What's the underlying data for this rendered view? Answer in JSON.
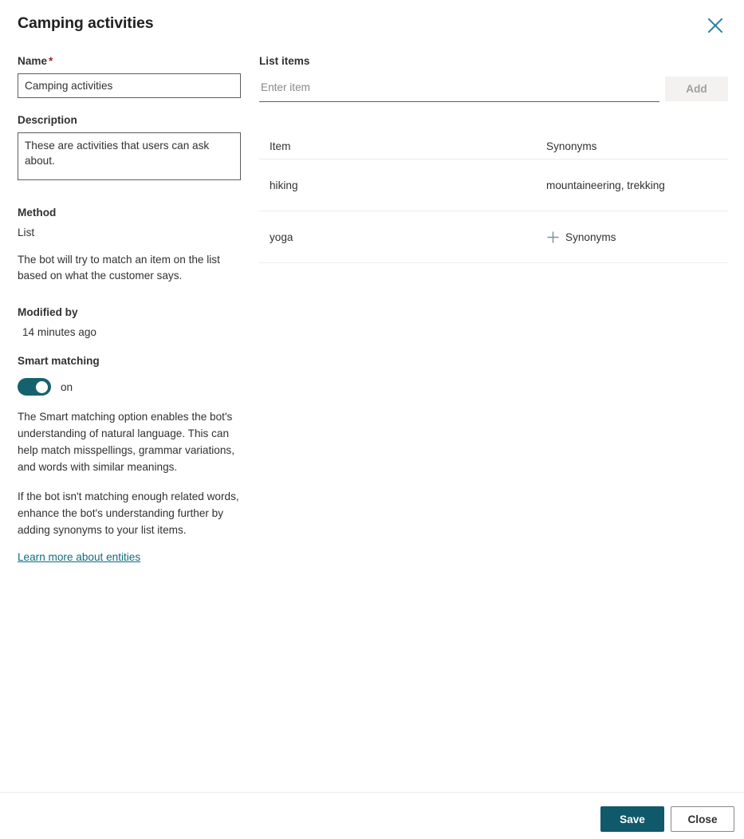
{
  "header": {
    "title": "Camping activities",
    "close_icon": "close-icon"
  },
  "form": {
    "name": {
      "label": "Name",
      "required_marker": "*",
      "value": "Camping activities",
      "placeholder": ""
    },
    "description": {
      "label": "Description",
      "value": "These are activities that users can ask about.",
      "placeholder": ""
    },
    "method": {
      "label": "Method",
      "value": "List",
      "helper": "The bot will try to match an item on the list based on what the customer says."
    },
    "modified_by": {
      "label": "Modified by",
      "value": "14 minutes ago"
    },
    "smart_matching": {
      "label": "Smart matching",
      "state_label": "on",
      "toggle_on": true,
      "paragraph_1": "The Smart matching option enables the bot's understanding of natural language. This can help match misspellings, grammar variations, and words with similar meanings.",
      "paragraph_2": "If the bot isn't matching enough related words, enhance the bot's understanding further by adding synonyms to your list items.",
      "learn_more": "Learn more about entities"
    }
  },
  "list_items": {
    "label": "List items",
    "input_placeholder": "Enter item",
    "input_value": "",
    "add_button": "Add",
    "add_button_disabled": true,
    "columns": {
      "item": "Item",
      "synonyms": "Synonyms"
    },
    "rows": [
      {
        "item": "hiking",
        "synonyms": "mountaineering, trekking",
        "has_synonyms": true,
        "add_synonyms_label": ""
      },
      {
        "item": "yoga",
        "synonyms": "",
        "has_synonyms": false,
        "add_synonyms_label": "Synonyms"
      }
    ]
  },
  "footer": {
    "save_label": "Save",
    "close_label": "Close"
  },
  "colors": {
    "accent_teal": "#10596b",
    "toggle_on": "#16616e",
    "link": "#0f6c80",
    "close_icon": "#1d7ea3",
    "required_star": "#a4262c",
    "plus_icon": "#7c949c",
    "disabled_button_bg": "#f3f2f1",
    "disabled_button_text": "#a19f9d",
    "divider": "#edebe9"
  }
}
